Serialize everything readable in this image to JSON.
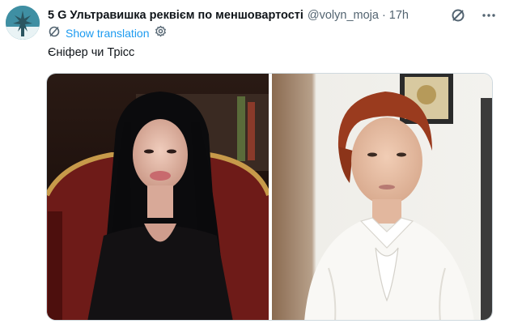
{
  "post": {
    "author_name": "5 G Ультравишка реквієм по меншовартості",
    "handle": "@volyn_moja",
    "separator": "·",
    "time": "17h",
    "show_translation": "Show translation",
    "text": "Єніфер чи Трісс"
  },
  "icons": {
    "avatar": "avatar",
    "grok": "slash-circle-icon",
    "more": "more-icon",
    "translate": "translate-icon",
    "settings": "settings-gear-icon"
  },
  "colors": {
    "link": "#1d9bf0",
    "secondary_text": "#536471",
    "primary_text": "#0f1419"
  }
}
